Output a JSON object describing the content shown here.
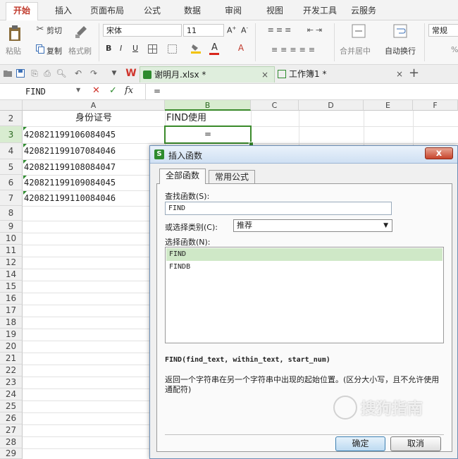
{
  "ribbon_tabs": [
    "开始",
    "插入",
    "页面布局",
    "公式",
    "数据",
    "审阅",
    "视图",
    "开发工具",
    "云服务"
  ],
  "ribbon": {
    "paste": "粘贴",
    "cut": "剪切",
    "copy": "复制",
    "format_painter": "格式刷",
    "font_name": "宋体",
    "font_size": "11",
    "bold": "B",
    "italic": "I",
    "underline": "U",
    "font_color_letter": "A",
    "merge_center": "合并居中",
    "wrap_text": "自动换行",
    "number_format": "常规",
    "percent": "%"
  },
  "doc_tabs": [
    {
      "name": "谢明月.xlsx *",
      "close": "×"
    },
    {
      "name": "工作簿1 *",
      "close": "×"
    }
  ],
  "doc_add": "+",
  "formula_bar": {
    "name_box": "FIND",
    "cancel": "✕",
    "confirm": "✓",
    "fx": "fx",
    "content": "="
  },
  "columns": [
    "A",
    "B",
    "C",
    "D",
    "E",
    "F"
  ],
  "rows": [
    "2",
    "3",
    "4",
    "5",
    "6",
    "7",
    "8",
    "9",
    "10",
    "11",
    "12",
    "14",
    "15",
    "16",
    "17",
    "18",
    "19",
    "20",
    "21",
    "22",
    "23",
    "24",
    "25",
    "26",
    "27",
    "28",
    "29"
  ],
  "cells": {
    "A2": "身份证号",
    "B2": "FIND使用",
    "B3": "=",
    "A3": "420821199106084045",
    "A4": "420821199107084046",
    "A5": "420821199108084047",
    "A6": "420821199109084045",
    "A7": "420821199110084046"
  },
  "dialog": {
    "title": "插入函数",
    "close": "x",
    "tabs": [
      "全部函数",
      "常用公式"
    ],
    "search_label": "查找函数(S):",
    "search_value": "FIND",
    "category_label": "或选择类别(C):",
    "category_value": "推荐",
    "select_label": "选择函数(N):",
    "functions": [
      "FIND",
      "FINDB"
    ],
    "selected_function": "FIND",
    "signature": "FIND(find_text, within_text, start_num)",
    "description": "返回一个字符串在另一个字符串中出现的起始位置。(区分大小写，且不允许使用通配符)",
    "ok": "确定",
    "cancel": "取消"
  },
  "watermark": "搜狗指南",
  "colors": {
    "active_tab_text": "#c0392b",
    "selection_green": "#3a8a2b",
    "selected_row_bg": "#cfe8c7",
    "dialog_border": "#6b8db5"
  }
}
